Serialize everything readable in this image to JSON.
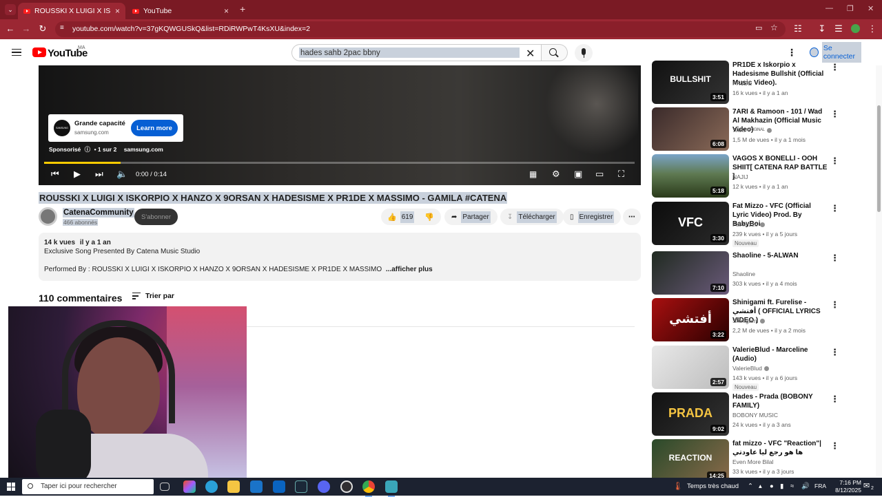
{
  "browser": {
    "tabs": [
      {
        "title": "ROUSSKI X LUIGI X ISKORPIO X",
        "active": true
      },
      {
        "title": "YouTube",
        "active": false
      }
    ],
    "new_tab": "+",
    "url": "youtube.com/watch?v=37gKQWGUSkQ&list=RDiRWPwT4KsXU&index=2",
    "accent": "#9b2733"
  },
  "yt_header": {
    "logo_text": "YouTube",
    "region": "MA",
    "search_value": "hades sahb 2pac bbny",
    "signin_label": "Se connecter"
  },
  "player": {
    "ad": {
      "logo_text": "SAMSUNG",
      "title": "Grande capacité",
      "domain": "samsung.com",
      "cta": "Learn more",
      "sponsored": "Sponsorisé",
      "ad_count": "• 1 sur 2",
      "ad_domain": "samsung.com"
    },
    "time": "0:00 / 0:14",
    "progress_fraction": 0.0,
    "ad_progress_fraction": 0.13
  },
  "video": {
    "title": "ROUSSKI X LUIGI X ISKORPIO X HANZO X 9ORSAN X HADESISME X PR1DE X MASSIMO - GAMILA #CATENA",
    "channel": "CatenaCommunity",
    "subscribers": "466 abonnés",
    "subscribe_label": "S'abonner",
    "likes": "619",
    "share_label": "Partager",
    "download_label": "Télécharger",
    "save_label": "Enregistrer"
  },
  "description": {
    "views": "14 k vues",
    "date": "il y a 1 an",
    "line1": "Exclusive Song Presented By Catena Music Studio",
    "line2": "Performed By : ROUSSKI X LUIGI X ISKORPIO X HANZO X 9ORSAN X HADESISME X PR1DE X MASSIMO",
    "more": "...afficher plus"
  },
  "comments": {
    "count": "110 commentaires",
    "sort_label": "Trier par"
  },
  "related": [
    {
      "title": "PR1DE x Iskorpio x Hadesisme Bullshit (Official Music Video).",
      "channel": "PR1DE",
      "verified": false,
      "meta": "16 k vues • il y a 1 an",
      "duration": "3:51",
      "thumb_text": "BULLSHIT",
      "badge": ""
    },
    {
      "title": "7ARI & Ramoon - 101 / Wad Al Makhazin (Official Music Video)",
      "channel": "7ARI ᴼᴿᴵᴳᴵᴺᴬᴸ",
      "verified": true,
      "meta": "1,5 M de vues • il y a 1 mois",
      "duration": "6:08",
      "thumb_text": "",
      "badge": ""
    },
    {
      "title": "VAGOS X BONELLI - OOH SHIIT[ CATENA RAP BATTLE ]",
      "channel": "NAJIJ",
      "verified": false,
      "meta": "12 k vues • il y a 1 an",
      "duration": "5:18",
      "thumb_text": "",
      "badge": ""
    },
    {
      "title": "Fat Mizzo - VFC (Official Lyric Video) Prod. By BabyBoi",
      "channel": "Fat Mizzo",
      "verified": true,
      "meta": "239 k vues • il y a 5 jours",
      "duration": "3:30",
      "thumb_text": "VFC",
      "badge": "Nouveau"
    },
    {
      "title": "Shaoline - 5-ALWAN",
      "channel": "Shaoline",
      "verified": false,
      "meta": "303 k vues • il y a 4 mois",
      "duration": "7:10",
      "thumb_text": "",
      "badge": ""
    },
    {
      "title": "Shinigami ft. Furelise - أفتشي ( OFFICIAL LYRICS VIDEO )",
      "channel": "Shinigami",
      "verified": true,
      "meta": "2,2 M de vues • il y a 2 mois",
      "duration": "3:22",
      "thumb_text": "أفتشي",
      "badge": ""
    },
    {
      "title": "ValerieBlud - Marceline (Audio)",
      "channel": "ValerieBlud",
      "verified": true,
      "meta": "143 k vues • il y a 6 jours",
      "duration": "2:57",
      "thumb_text": "",
      "badge": "Nouveau"
    },
    {
      "title": "Hades - Prada (BOBONY FAMILY)",
      "channel": "BOBONY MUSIC",
      "verified": false,
      "meta": "24 k vues • il y a 3 ans",
      "duration": "9:02",
      "thumb_text": "PRADA",
      "badge": ""
    },
    {
      "title": "fat mizzo - VFC \"Reaction\"| ها هو رجع ليا عاودتي",
      "channel": "Even More Bilal",
      "verified": false,
      "meta": "33 k vues • il y a 3 jours",
      "duration": "14:25",
      "thumb_text": "REACTION",
      "badge": ""
    }
  ],
  "taskbar": {
    "search_placeholder": "Taper ici pour rechercher",
    "weather": "Temps très chaud",
    "language": "FRA",
    "time": "7:16 PM",
    "date": "8/12/2025",
    "notifications": "2"
  }
}
